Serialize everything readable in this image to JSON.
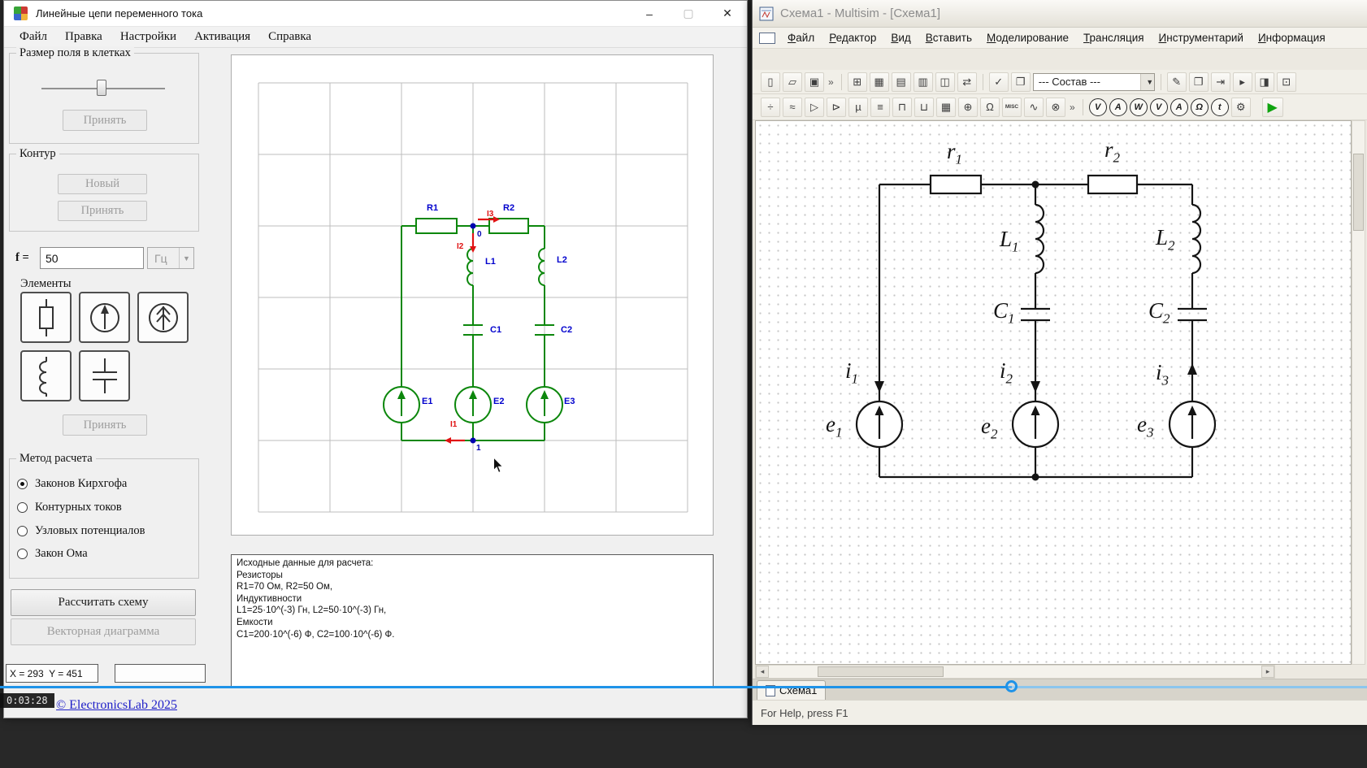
{
  "video_player": {
    "timestamp": "0:03:28"
  },
  "left_app": {
    "title": "Линейные цепи переменного тока",
    "controls": {
      "minimize": "–",
      "maximize": "▢",
      "close": "✕"
    },
    "menu": [
      "Файл",
      "Правка",
      "Настройки",
      "Активация",
      "Справка"
    ],
    "sidebar": {
      "grid_group_title": "Размер поля в клетках",
      "grid_accept": "Принять",
      "contour_title": "Контур",
      "contour_new": "Новый",
      "contour_accept": "Принять",
      "freq_label": "f =",
      "freq_value": "50",
      "freq_unit": "Гц",
      "elements_title": "Элементы",
      "elements_accept": "Принять",
      "method_title": "Метод расчета",
      "method_options": [
        "Законов Кирхгофа",
        "Контурных токов",
        "Узловых потенциалов",
        "Закон Ома"
      ],
      "method_selected_index": 0,
      "calc_button": "Рассчитать схему",
      "vector_button": "Векторная диаграмма"
    },
    "schematic": {
      "r1": "R1",
      "r2": "R2",
      "l1": "L1",
      "l2": "L2",
      "c1": "C1",
      "c2": "C2",
      "e1": "E1",
      "e2": "E2",
      "e3": "E3",
      "i1": "I1",
      "i2": "I2",
      "i3": "I3",
      "node0": "0",
      "node1": "1",
      "wire_color": "#0c870c",
      "label_color": "#0000cd",
      "current_color": "#e01212"
    },
    "info_lines": [
      "Исходные данные для расчета:",
      "Резисторы",
      "R1=70 Ом, R2=50 Ом,",
      "Индуктивности",
      "L1=25·10^(-3) Гн, L2=50·10^(-3) Гн,",
      "Емкости",
      "C1=200·10^(-6) Ф, C2=100·10^(-6) Ф."
    ],
    "status_coords": "X = 293  Y = 451",
    "footer_link": "© ElectronicsLab 2025"
  },
  "right_app": {
    "title": "Схема1 - Multisim - [Схема1]",
    "menu": [
      "Файл",
      "Редактор",
      "Вид",
      "Вставить",
      "Моделирование",
      "Трансляция",
      "Инструментарий",
      "Информация"
    ],
    "toolbar_main": {
      "icons": [
        {
          "name": "new-file",
          "glyph": "▯"
        },
        {
          "name": "open-file",
          "glyph": "▱"
        },
        {
          "name": "save",
          "glyph": "▣"
        },
        {
          "name": "grid",
          "glyph": "⊞"
        },
        {
          "name": "spreadsheet",
          "glyph": "▦"
        },
        {
          "name": "table",
          "glyph": "▤"
        },
        {
          "name": "report",
          "glyph": "▥"
        },
        {
          "name": "views",
          "glyph": "◫"
        },
        {
          "name": "transfer",
          "glyph": "⇄"
        },
        {
          "name": "check",
          "glyph": "✓"
        },
        {
          "name": "copy-pages",
          "glyph": "❐"
        }
      ],
      "overflow": "»",
      "combo_value": "--- Состав ---",
      "right_icons": [
        {
          "name": "edit",
          "glyph": "✎"
        },
        {
          "name": "duplicate",
          "glyph": "❐"
        },
        {
          "name": "export",
          "glyph": "⇥"
        },
        {
          "name": "run-small",
          "glyph": "▸"
        },
        {
          "name": "panel",
          "glyph": "◨"
        },
        {
          "name": "target",
          "glyph": "⊡"
        }
      ]
    },
    "toolbar_components": {
      "icons": [
        {
          "name": "sources",
          "glyph": "÷"
        },
        {
          "name": "basic",
          "glyph": "≈"
        },
        {
          "name": "diode",
          "glyph": "▷"
        },
        {
          "name": "transistor",
          "glyph": "⊳"
        },
        {
          "name": "analog",
          "glyph": "µ"
        },
        {
          "name": "ttl",
          "glyph": "≡"
        },
        {
          "name": "cmos",
          "glyph": "⊓"
        },
        {
          "name": "misc-digital",
          "glyph": "⊔"
        },
        {
          "name": "mixed",
          "glyph": "▦"
        },
        {
          "name": "indicator",
          "glyph": "⊕"
        },
        {
          "name": "power",
          "glyph": "Ω"
        },
        {
          "name": "misc",
          "glyph": "MISC"
        },
        {
          "name": "rf",
          "glyph": "∿"
        },
        {
          "name": "electromech",
          "glyph": "⊗"
        }
      ],
      "overflow": "»",
      "instruments": [
        "V",
        "A",
        "W",
        "V",
        "A",
        "Ω",
        "t"
      ],
      "gear": "⚙",
      "run_glyph": "▶"
    },
    "schematic": {
      "r1": {
        "sym": "r",
        "sub": "1"
      },
      "r2": {
        "sym": "r",
        "sub": "2"
      },
      "l1": {
        "sym": "L",
        "sub": "1"
      },
      "l2": {
        "sym": "L",
        "sub": "2"
      },
      "c1": {
        "sym": "C",
        "sub": "1"
      },
      "c2": {
        "sym": "C",
        "sub": "2"
      },
      "i1": {
        "sym": "i",
        "sub": "1"
      },
      "i2": {
        "sym": "i",
        "sub": "2"
      },
      "i3": {
        "sym": "i",
        "sub": "3"
      },
      "e1": {
        "sym": "e",
        "sub": "1"
      },
      "e2": {
        "sym": "e",
        "sub": "2"
      },
      "e3": {
        "sym": "e",
        "sub": "3"
      }
    },
    "doc_tab": "Схема1",
    "status_hint": "For Help, press F1"
  }
}
